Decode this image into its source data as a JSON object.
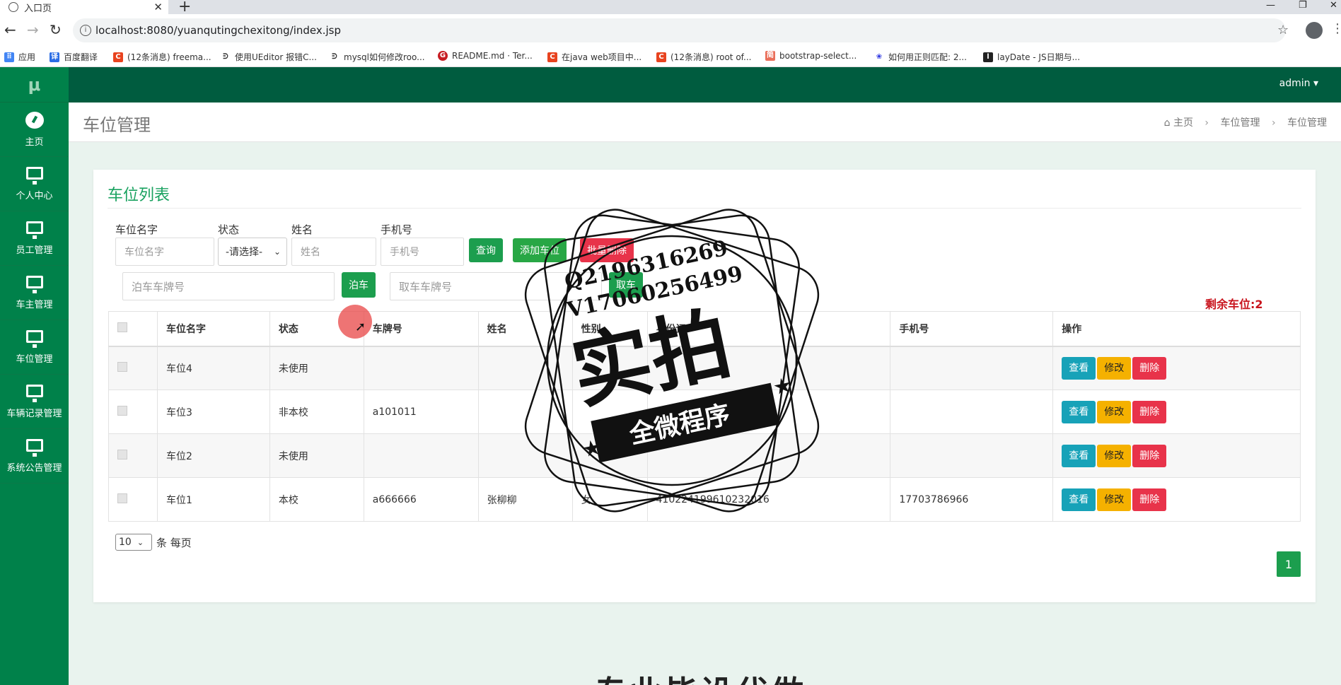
{
  "browser": {
    "tab_title": "入口页",
    "url": "localhost:8080/yuanqutingchexitong/index.jsp",
    "bookmarks": [
      {
        "label": "应用",
        "icon": "apps-grid-icon",
        "color": "#4285f4"
      },
      {
        "label": "百度翻译",
        "icon": "baidu-translate-icon",
        "color": "#2b6de5"
      },
      {
        "label": "(12条消息) freema...",
        "icon": "csdn-icon",
        "color": "#e8431f"
      },
      {
        "label": "使用UEditor 报错C...",
        "icon": "page-icon",
        "color": "#333333"
      },
      {
        "label": "mysql如何修改roo...",
        "icon": "page-icon",
        "color": "#333333"
      },
      {
        "label": "README.md · Ter...",
        "icon": "gitee-icon",
        "color": "#c71d23"
      },
      {
        "label": "在java web项目中...",
        "icon": "csdn-icon",
        "color": "#e8431f"
      },
      {
        "label": "(12条消息) root of...",
        "icon": "csdn-icon",
        "color": "#e8431f"
      },
      {
        "label": "bootstrap-select...",
        "icon": "jianshu-icon",
        "color": "#ea6f5a"
      },
      {
        "label": "如何用正则匹配: 2...",
        "icon": "baidu-paw-icon",
        "color": "#2932e1"
      },
      {
        "label": "layDate - JS日期与...",
        "icon": "layui-icon",
        "color": "#222222"
      }
    ]
  },
  "sidebar": {
    "logo": "μ",
    "items": [
      {
        "label": "主页",
        "icon": "dashboard-icon"
      },
      {
        "label": "个人中心",
        "icon": "monitor-icon"
      },
      {
        "label": "员工管理",
        "icon": "monitor-icon"
      },
      {
        "label": "车主管理",
        "icon": "monitor-icon"
      },
      {
        "label": "车位管理",
        "icon": "monitor-icon"
      },
      {
        "label": "车辆记录管理",
        "icon": "monitor-icon"
      },
      {
        "label": "系统公告管理",
        "icon": "monitor-icon"
      }
    ]
  },
  "topnav": {
    "user": "admin ▾"
  },
  "header": {
    "title": "车位管理",
    "breadcrumb": [
      "主页",
      "车位管理",
      "车位管理"
    ]
  },
  "card": {
    "title": "车位列表",
    "filters": {
      "name_label": "车位名字",
      "name_placeholder": "车位名字",
      "status_label": "状态",
      "status_value": "-请选择-",
      "person_label": "姓名",
      "person_placeholder": "姓名",
      "phone_label": "手机号",
      "phone_placeholder": "手机号"
    },
    "buttons": {
      "search": "查询",
      "add": "添加车位",
      "batch_delete": "批量删除",
      "park": "泊车",
      "pickup": "取车"
    },
    "park_placeholder": "泊车车牌号",
    "pickup_placeholder": "取车车牌号",
    "remaining": "剩余车位:2"
  },
  "table": {
    "headers": [
      "车位名字",
      "状态",
      "车牌号",
      "姓名",
      "性别",
      "身份证",
      "手机号",
      "操作"
    ],
    "rows": [
      {
        "name": "车位4",
        "status": "未使用",
        "plate": "",
        "person": "",
        "gender": "",
        "idcard": "",
        "phone": ""
      },
      {
        "name": "车位3",
        "status": "非本校",
        "plate": "a101011",
        "person": "",
        "gender": "",
        "idcard": "",
        "phone": ""
      },
      {
        "name": "车位2",
        "status": "未使用",
        "plate": "",
        "person": "",
        "gender": "",
        "idcard": "",
        "phone": ""
      },
      {
        "name": "车位1",
        "status": "本校",
        "plate": "a666666",
        "person": "张柳柳",
        "gender": "女",
        "idcard": "410224199610232016",
        "phone": "17703786966"
      }
    ],
    "actions": {
      "view": "查看",
      "edit": "修改",
      "delete": "删除"
    }
  },
  "pagination": {
    "page_size": "10",
    "per_page_text": "条 每页",
    "current_page": "1"
  },
  "footer_text": "专业毕设代做",
  "watermark": {
    "line1": "Q2196316269",
    "line2": "V17060256499",
    "big": "实拍",
    "ribbon": "全微程序"
  }
}
